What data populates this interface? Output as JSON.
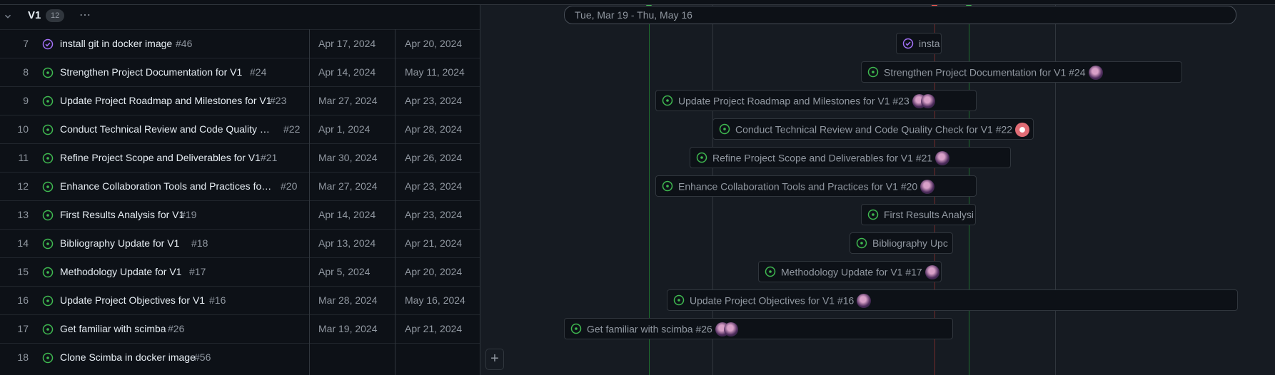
{
  "group": {
    "name": "V1",
    "count": "12"
  },
  "range_label": "Tue, Mar 19 - Thu, May 16",
  "colors": {
    "open": "#3fb950",
    "closed": "#a371f7",
    "today": "#f85149",
    "milestone": "#3fb950"
  },
  "rows": [
    {
      "num": "7",
      "title": "install git in docker image",
      "ref": "#46",
      "start": "Apr 17, 2024",
      "end": "Apr 20, 2024",
      "status": "closed",
      "bar_label": "insta",
      "avatars": 0
    },
    {
      "num": "8",
      "title": "Strengthen Project Documentation for V1",
      "ref": "#24",
      "start": "Apr 14, 2024",
      "end": "May 11, 2024",
      "status": "open",
      "bar_label": "Strengthen Project Documentation for V1 #24",
      "avatars": 1
    },
    {
      "num": "9",
      "title": "Update Project Roadmap and Milestones for V1",
      "ref": "#23",
      "start": "Mar 27, 2024",
      "end": "Apr 23, 2024",
      "status": "open",
      "bar_label": "Update Project Roadmap and Milestones for V1 #23",
      "avatars": 2
    },
    {
      "num": "10",
      "title": "Conduct Technical Review and Code Quality Ch...",
      "ref": "#22",
      "start": "Apr 1, 2024",
      "end": "Apr 28, 2024",
      "status": "open",
      "bar_label": "Conduct Technical Review and Code Quality Check for V1 #22",
      "avatars": 1
    },
    {
      "num": "11",
      "title": "Refine Project Scope and Deliverables for V1",
      "ref": "#21",
      "start": "Mar 30, 2024",
      "end": "Apr 26, 2024",
      "status": "open",
      "bar_label": "Refine Project Scope and Deliverables for V1 #21",
      "avatars": 1
    },
    {
      "num": "12",
      "title": "Enhance Collaboration Tools and Practices for V1",
      "ref": "#20",
      "start": "Mar 27, 2024",
      "end": "Apr 23, 2024",
      "status": "open",
      "bar_label": "Enhance Collaboration Tools and Practices for V1 #20",
      "avatars": 1
    },
    {
      "num": "13",
      "title": "First Results Analysis for V1",
      "ref": "#19",
      "start": "Apr 14, 2024",
      "end": "Apr 23, 2024",
      "status": "open",
      "bar_label": "First Results Analysi",
      "avatars": 0
    },
    {
      "num": "14",
      "title": "Bibliography Update for V1",
      "ref": "#18",
      "start": "Apr 13, 2024",
      "end": "Apr 21, 2024",
      "status": "open",
      "bar_label": "Bibliography Upc",
      "avatars": 0
    },
    {
      "num": "15",
      "title": "Methodology Update for V1",
      "ref": "#17",
      "start": "Apr 5, 2024",
      "end": "Apr 20, 2024",
      "status": "open",
      "bar_label": "Methodology Update for V1 #17",
      "avatars": 1
    },
    {
      "num": "16",
      "title": "Update Project Objectives for V1",
      "ref": "#16",
      "start": "Mar 28, 2024",
      "end": "May 16, 2024",
      "status": "open",
      "bar_label": "Update Project Objectives for V1 #16",
      "avatars": 1
    },
    {
      "num": "17",
      "title": "Get familiar with scimba",
      "ref": "#26",
      "start": "Mar 19, 2024",
      "end": "Apr 21, 2024",
      "status": "open",
      "bar_label": "Get familiar with scimba #26",
      "avatars": 2
    },
    {
      "num": "18",
      "title": "Clone Scimba in docker image",
      "ref": "#56",
      "start": "",
      "end": "",
      "status": "open",
      "bar_label": "",
      "avatars": 0
    }
  ]
}
